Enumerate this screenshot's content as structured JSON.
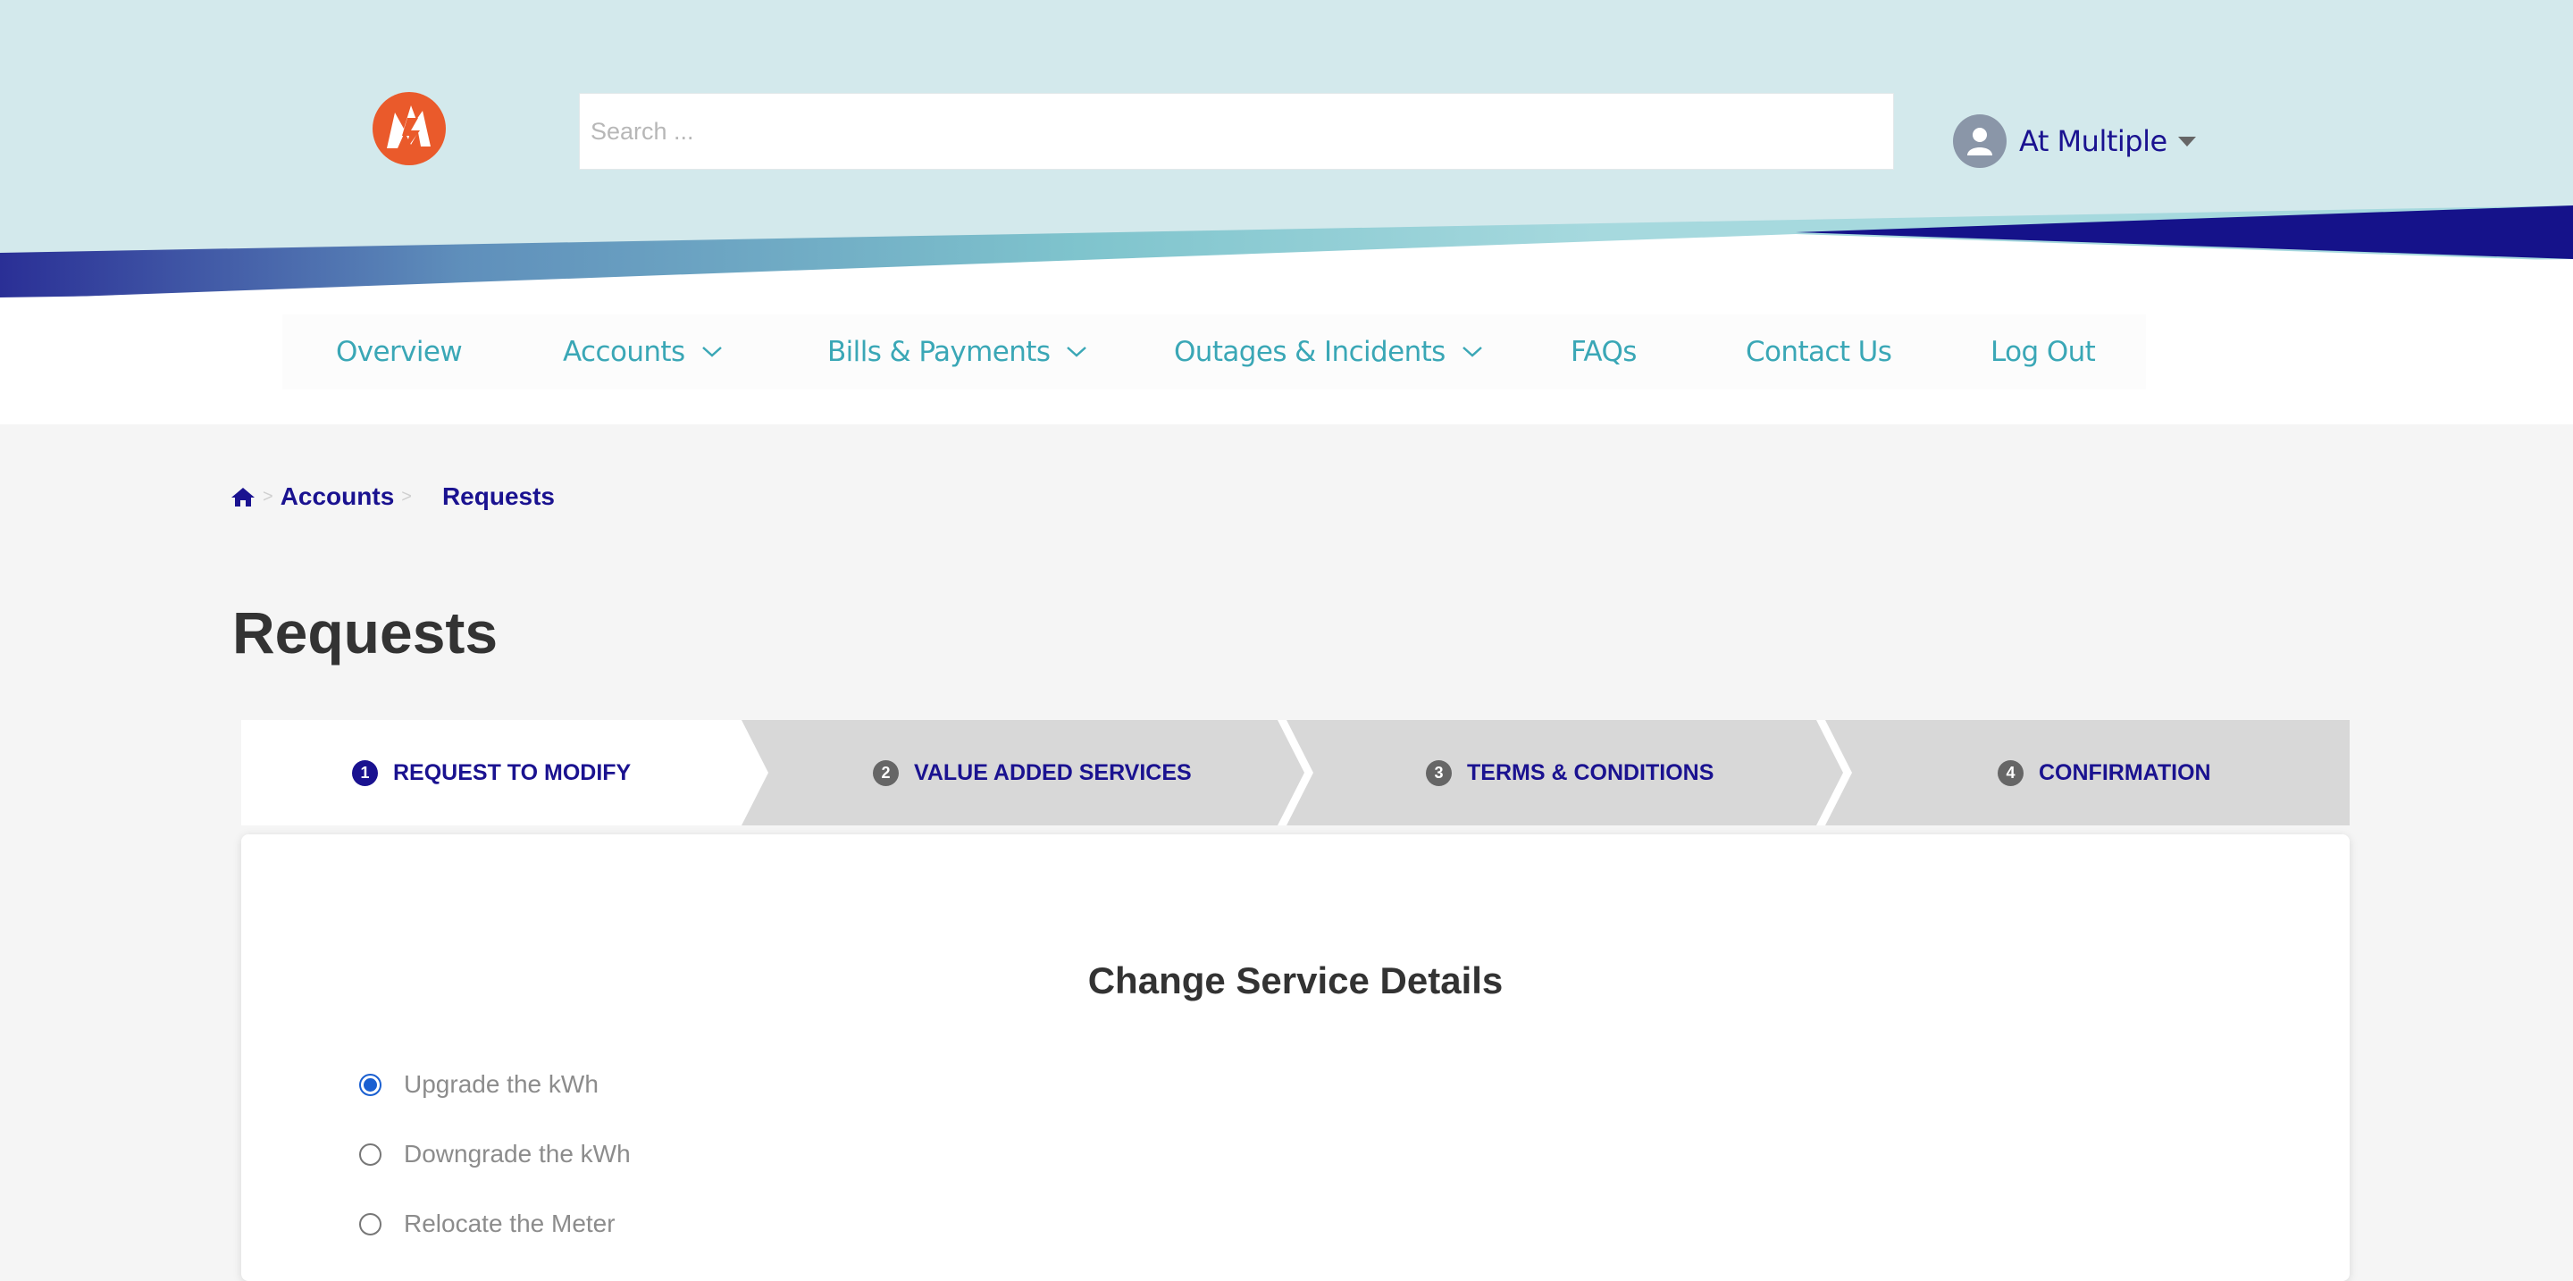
{
  "search": {
    "placeholder": "Search ..."
  },
  "user": {
    "name": "At Multiple",
    "icon": "user-avatar-icon"
  },
  "nav": [
    {
      "label": "Overview",
      "dropdown": false
    },
    {
      "label": "Accounts",
      "dropdown": true
    },
    {
      "label": "Bills & Payments",
      "dropdown": true
    },
    {
      "label": "Outages & Incidents",
      "dropdown": true
    },
    {
      "label": "FAQs",
      "dropdown": false
    },
    {
      "label": "Contact Us",
      "dropdown": false
    },
    {
      "label": "Log Out",
      "dropdown": false
    }
  ],
  "breadcrumb": {
    "home_icon": "home-icon",
    "items": [
      "Accounts",
      "Requests"
    ]
  },
  "page_title": "Requests",
  "steps": [
    {
      "number": "1",
      "label": "REQUEST TO MODIFY",
      "active": true
    },
    {
      "number": "2",
      "label": "VALUE ADDED SERVICES",
      "active": false
    },
    {
      "number": "3",
      "label": "TERMS & CONDITIONS",
      "active": false
    },
    {
      "number": "4",
      "label": "CONFIRMATION",
      "active": false
    }
  ],
  "form": {
    "title": "Change Service Details",
    "options": [
      {
        "label": "Upgrade the kWh",
        "checked": true
      },
      {
        "label": "Downgrade the kWh",
        "checked": false
      },
      {
        "label": "Relocate the Meter",
        "checked": false
      }
    ]
  },
  "colors": {
    "brand_navy": "#1a1290",
    "nav_teal": "#3aa7b6",
    "header_bg": "#d3e9ec",
    "logo_orange": "#ea5a2b",
    "radio_blue": "#1a5fd1"
  }
}
